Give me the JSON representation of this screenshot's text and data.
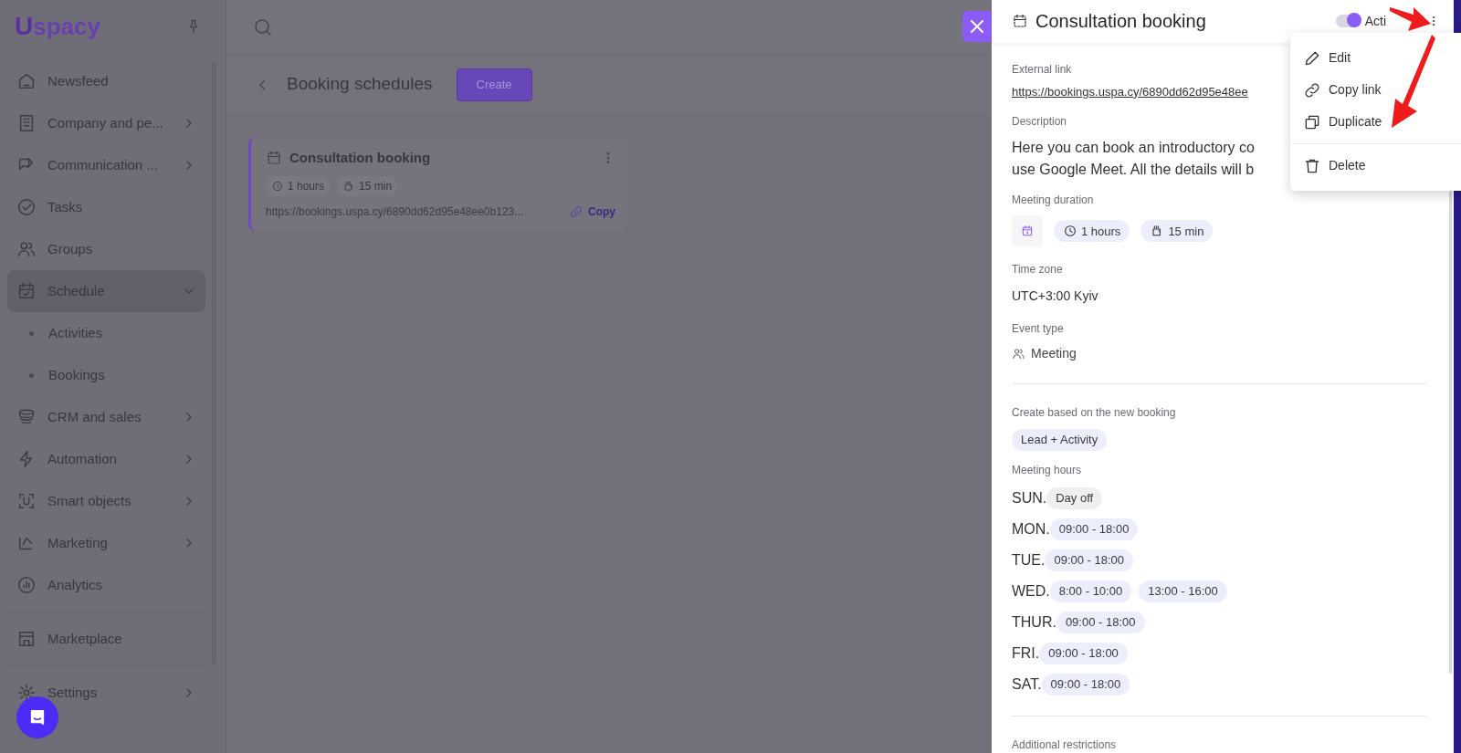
{
  "logo": {
    "mark": "U",
    "name": "spacy"
  },
  "sidebar": {
    "sections": [
      {
        "items": [
          {
            "label": "Newsfeed",
            "selected": false
          },
          {
            "label": "Company and pe...",
            "selected": false,
            "expanded": false
          },
          {
            "label": "Communication ...",
            "selected": false,
            "expanded": false
          },
          {
            "label": "Tasks",
            "selected": false
          },
          {
            "label": "Groups",
            "selected": false
          },
          {
            "label": "Schedule",
            "selected": true,
            "expanded": true,
            "children": [
              {
                "label": "Activities"
              },
              {
                "label": "Bookings"
              }
            ]
          },
          {
            "label": "CRM and sales",
            "selected": false,
            "expanded": false
          },
          {
            "label": "Automation",
            "selected": false,
            "expanded": false
          },
          {
            "label": "Smart objects",
            "selected": false,
            "expanded": false
          },
          {
            "label": "Marketing",
            "selected": false,
            "expanded": false
          },
          {
            "label": "Analytics",
            "selected": false
          }
        ]
      },
      {
        "items": [
          {
            "label": "Marketplace",
            "selected": false
          }
        ]
      },
      {
        "items": [
          {
            "label": "Settings",
            "selected": false,
            "expanded": false
          }
        ]
      }
    ]
  },
  "main": {
    "page_title": "Booking schedules",
    "create_button": "Create",
    "cards": [
      {
        "title": "Consultation booking",
        "duration": "1 hours",
        "break": "15 min",
        "link": "https://bookings.uspa.cy/6890dd62d95e48ee0b123...",
        "copy": "Copy"
      }
    ]
  },
  "drawer": {
    "title": "Consultation booking",
    "status": {
      "label": "Acti",
      "on": true
    },
    "external_link": {
      "label": "External link",
      "value": "https://bookings.uspa.cy/6890dd62d95e48ee"
    },
    "description": {
      "label": "Description",
      "lines": [
        "Here you can book an introductory co",
        "use Google Meet. All the details will b"
      ]
    },
    "meeting_duration": {
      "label": "Meeting duration",
      "duration": "1 hours",
      "break": "15 min"
    },
    "time_zone": {
      "label": "Time zone",
      "value": "UTC+3:00 Kyiv"
    },
    "event_type": {
      "label": "Event type",
      "value": "Meeting"
    },
    "create_based": {
      "label": "Create based on the new booking",
      "value": "Lead + Activity"
    },
    "meeting_hours": {
      "label": "Meeting hours",
      "days": [
        {
          "day": "SUN.",
          "off": true,
          "slots": [
            "Day off"
          ]
        },
        {
          "day": "MON.",
          "off": false,
          "slots": [
            "09:00 - 18:00"
          ]
        },
        {
          "day": "TUE.",
          "off": false,
          "slots": [
            "09:00 - 18:00"
          ]
        },
        {
          "day": "WED.",
          "off": false,
          "slots": [
            "8:00 - 10:00",
            "13:00 - 16:00"
          ]
        },
        {
          "day": "THUR.",
          "off": false,
          "slots": [
            "09:00 - 18:00"
          ]
        },
        {
          "day": "FRI.",
          "off": false,
          "slots": [
            "09:00 - 18:00"
          ]
        },
        {
          "day": "SAT.",
          "off": false,
          "slots": [
            "09:00 - 18:00"
          ]
        }
      ]
    },
    "additional_restrictions": {
      "label": "Additional restrictions"
    },
    "menu": {
      "sections": [
        {
          "items": [
            {
              "label": "Edit",
              "kind": "edit"
            },
            {
              "label": "Copy link",
              "kind": "link"
            },
            {
              "label": "Duplicate",
              "kind": "duplicate"
            }
          ]
        },
        {
          "items": [
            {
              "label": "Delete",
              "kind": "delete"
            }
          ]
        }
      ]
    }
  }
}
